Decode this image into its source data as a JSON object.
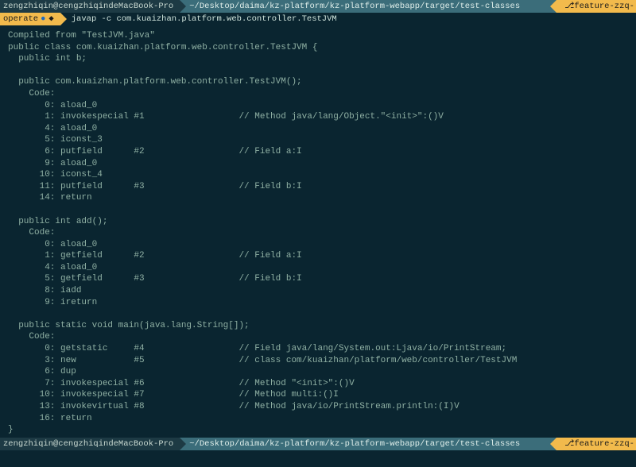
{
  "top_bar": {
    "host": "zengzhiqin@cengzhiqindeMacBook-Pro",
    "path": "~/Desktop/daima/kz-platform/kz-platform-webapp/target/test-classes",
    "branch_icon": "⎇",
    "branch": " feature-zzq-"
  },
  "cmd_bar": {
    "op": "operate",
    "dot": "●",
    "diamond": "◆",
    "command": "javap -c com.kuaizhan.platform.web.controller.TestJVM"
  },
  "output_lines": [
    "Compiled from \"TestJVM.java\"",
    "public class com.kuaizhan.platform.web.controller.TestJVM {",
    "  public int b;",
    "",
    "  public com.kuaizhan.platform.web.controller.TestJVM();",
    "    Code:",
    "       0: aload_0",
    "       1: invokespecial #1                  // Method java/lang/Object.\"<init>\":()V",
    "       4: aload_0",
    "       5: iconst_3",
    "       6: putfield      #2                  // Field a:I",
    "       9: aload_0",
    "      10: iconst_4",
    "      11: putfield      #3                  // Field b:I",
    "      14: return",
    "",
    "  public int add();",
    "    Code:",
    "       0: aload_0",
    "       1: getfield      #2                  // Field a:I",
    "       4: aload_0",
    "       5: getfield      #3                  // Field b:I",
    "       8: iadd",
    "       9: ireturn",
    "",
    "  public static void main(java.lang.String[]);",
    "    Code:",
    "       0: getstatic     #4                  // Field java/lang/System.out:Ljava/io/PrintStream;",
    "       3: new           #5                  // class com/kuaizhan/platform/web/controller/TestJVM",
    "       6: dup",
    "       7: invokespecial #6                  // Method \"<init>\":()V",
    "      10: invokespecial #7                  // Method multi:()I",
    "      13: invokevirtual #8                  // Method java/io/PrintStream.println:(I)V",
    "      16: return",
    "}"
  ],
  "bottom_bar": {
    "host": "zengzhiqin@cengzhiqindeMacBook-Pro",
    "path": "~/Desktop/daima/kz-platform/kz-platform-webapp/target/test-classes",
    "branch_icon": "⎇",
    "branch": " feature-zzq-"
  }
}
